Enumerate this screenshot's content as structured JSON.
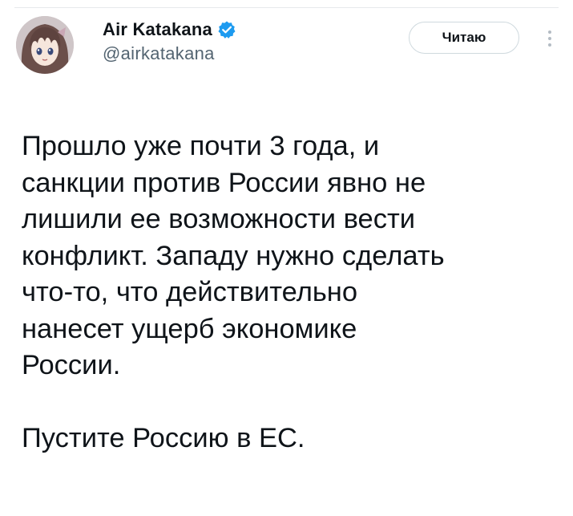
{
  "author": {
    "display_name": "Air Katakana",
    "handle": "@airkatakana",
    "verified": true
  },
  "actions": {
    "follow_label": "Читаю"
  },
  "icons": {
    "verified": "verified-badge-icon",
    "more": "more-vertical-icon"
  },
  "colors": {
    "verified_blue": "#1d9bf0",
    "handle_gray": "#536471",
    "text": "#0f1419"
  },
  "tweet": {
    "lines": [
      "Прошло уже почти 3 года, и",
      "санкции против России явно не",
      "лишили ее возможности вести",
      "конфликт. Западу нужно сделать",
      "что-то, что действительно",
      "нанесет ущерб экономике",
      "России."
    ],
    "closing": "Пустите Россию в ЕС."
  }
}
